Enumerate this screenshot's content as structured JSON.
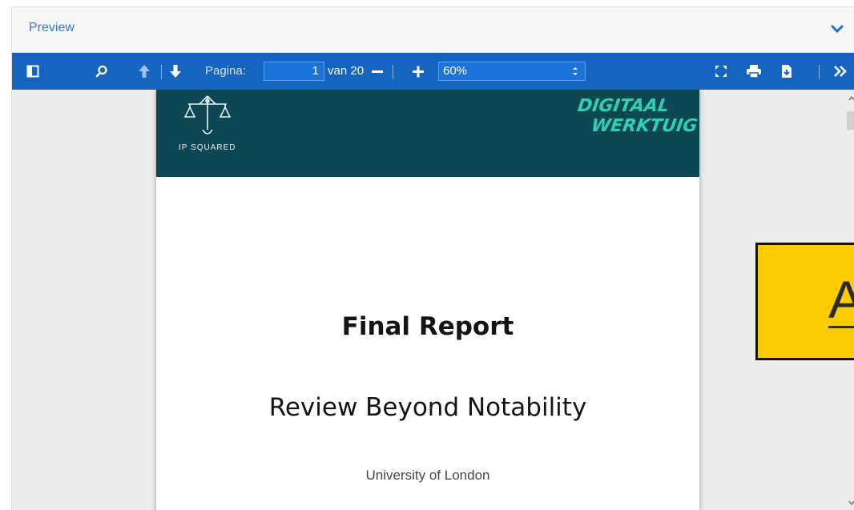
{
  "panel": {
    "title": "Preview"
  },
  "toolbar": {
    "page_label": "Pagina:",
    "page_value": "1",
    "page_total": "van 20",
    "zoom_value": "60%",
    "icons": [
      "sidebar-toggle-icon",
      "search-icon",
      "previous-page-icon",
      "next-page-icon",
      "zoom-out-icon",
      "zoom-in-icon",
      "presentation-mode-icon",
      "print-icon",
      "download-icon",
      "more-tools-icon"
    ]
  },
  "document": {
    "logo_text": "IP SQUARED",
    "brand_line1": "DIGITAAL",
    "brand_line2": "WERKTUIG",
    "title": "Final Report",
    "subtitle": "Review Beyond Notability",
    "organization": "University of London"
  },
  "overlay": {
    "letter": "A"
  },
  "colors": {
    "toolbar": "#1565c0",
    "banner": "#0d4754",
    "brand_accent": "#2fd0ad",
    "overlay": "#fccc00",
    "panel_title": "#3a78c3"
  }
}
